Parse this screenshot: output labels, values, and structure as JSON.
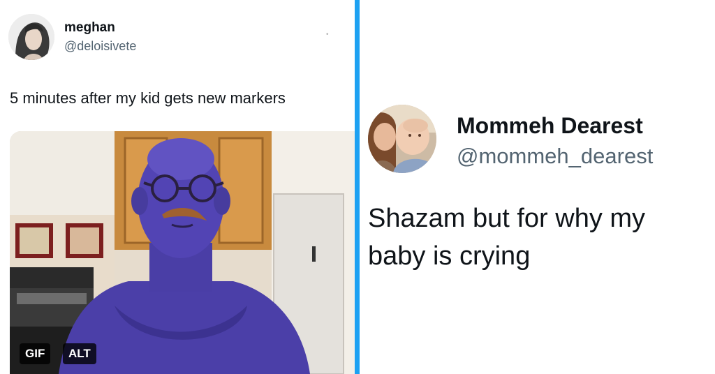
{
  "left_tweet": {
    "display_name": "meghan",
    "handle": "@deloisivete",
    "text": "5 minutes after my kid gets new markers",
    "media": {
      "badge_gif": "GIF",
      "badge_alt": "ALT"
    }
  },
  "right_tweet": {
    "display_name": "Mommeh Dearest",
    "handle": "@mommeh_dearest",
    "text": "Shazam but for why my baby is crying"
  },
  "colors": {
    "divider": "#1da1f2",
    "text": "#0f1419",
    "handle": "#536471"
  }
}
